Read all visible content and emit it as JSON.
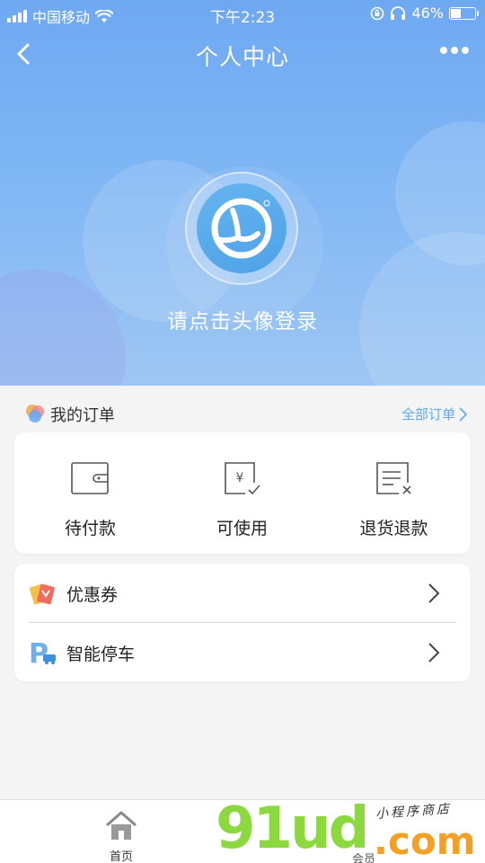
{
  "status_bar": {
    "carrier": "中国移动",
    "time": "下午2:23",
    "battery_percent": "46%",
    "battery_level": 0.46
  },
  "nav": {
    "title": "个人中心"
  },
  "profile": {
    "login_prompt": "请点击头像登录"
  },
  "orders": {
    "title": "我的订单",
    "all_link": "全部订单",
    "items": [
      {
        "label": "待付款",
        "icon": "wallet-icon"
      },
      {
        "label": "可使用",
        "icon": "receipt-check-icon"
      },
      {
        "label": "退货退款",
        "icon": "refund-list-icon"
      }
    ]
  },
  "menu": {
    "items": [
      {
        "label": "优惠券",
        "icon": "coupon-icon"
      },
      {
        "label": "智能停车",
        "icon": "parking-icon"
      }
    ]
  },
  "tab_bar": {
    "items": [
      {
        "label": "首页",
        "icon": "home-icon"
      },
      {
        "label": "会员",
        "icon": "member-icon"
      }
    ]
  },
  "watermark": {
    "main": "91ud",
    "suffix": ".com",
    "sub": "小程序商店"
  },
  "colors": {
    "hero_top": "#6ea8f1",
    "hero_bottom": "#9ec6f3",
    "accent_link": "#5fa8f2",
    "watermark_green": "#8bd93f",
    "watermark_orange": "#f4a024"
  }
}
